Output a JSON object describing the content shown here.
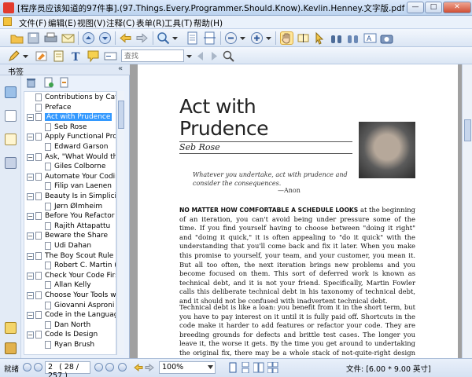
{
  "window": {
    "title": "[程序员应该知道的97件事].(97.Things.Every.Programmer.Should.Know).Kevlin.Henney.文字版.pdf - 福昕阅读器 - [程序员应该知",
    "minimize": "—",
    "maximize": "□",
    "close": "✕"
  },
  "menu": {
    "items": [
      "文件(F)",
      "编辑(E)",
      "视图(V)",
      "注释(C)",
      "表单(R)",
      "工具(T)",
      "帮助(H)"
    ]
  },
  "toolbar": {
    "search_placeholder": "查找"
  },
  "leftpane": {
    "header_label": "书签",
    "collapse_glyph": "«",
    "bookmarks": [
      {
        "label": "Contributions by Catego",
        "type": "chapter",
        "expander": ""
      },
      {
        "label": "Preface",
        "type": "chapter",
        "expander": ""
      },
      {
        "label": "Act with Prudence",
        "type": "chapter",
        "expander": "−",
        "selected": true
      },
      {
        "label": "Seb Rose",
        "type": "author"
      },
      {
        "label": "Apply Functional Progra",
        "type": "chapter",
        "expander": "−"
      },
      {
        "label": "Edward Garson",
        "type": "author"
      },
      {
        "label": "Ask, \"What Would the",
        "type": "chapter",
        "expander": "−"
      },
      {
        "label": "Giles Colborne",
        "type": "author"
      },
      {
        "label": "Automate Your Coding",
        "type": "chapter",
        "expander": "−"
      },
      {
        "label": "Filip van Laenen",
        "type": "author"
      },
      {
        "label": "Beauty Is in Simplicity",
        "type": "chapter",
        "expander": "−"
      },
      {
        "label": "Jørn Ølmheim",
        "type": "author"
      },
      {
        "label": "Before You Refactor",
        "type": "chapter",
        "expander": "−"
      },
      {
        "label": "Rajith Attapattu",
        "type": "author"
      },
      {
        "label": "Beware the Share",
        "type": "chapter",
        "expander": "−"
      },
      {
        "label": "Udi Dahan",
        "type": "author"
      },
      {
        "label": "The Boy Scout Rule",
        "type": "chapter",
        "expander": "−"
      },
      {
        "label": "Robert C. Martin (Un",
        "type": "author"
      },
      {
        "label": "Check Your Code First I",
        "type": "chapter",
        "expander": "−"
      },
      {
        "label": "Allan Kelly",
        "type": "author"
      },
      {
        "label": "Choose Your Tools with",
        "type": "chapter",
        "expander": "−"
      },
      {
        "label": "Giovanni Asproni",
        "type": "author"
      },
      {
        "label": "Code in the Language o",
        "type": "chapter",
        "expander": "−"
      },
      {
        "label": "Dan North",
        "type": "author"
      },
      {
        "label": "Code Is Design",
        "type": "chapter",
        "expander": "−"
      },
      {
        "label": "Ryan Brush",
        "type": "author"
      }
    ]
  },
  "document": {
    "chapter_title_line1": "Act with",
    "chapter_title_line2": "Prudence",
    "author": "Seb Rose",
    "quote": "Whatever you undertake, act with prudence and consider the consequences.",
    "quote_attribution": "—Anon",
    "para1_lead": "NO MATTER HOW COMFORTABLE A SCHEDULE LOOKS",
    "para1": " at the beginning of an iteration, you can't avoid being under pressure some of the time. If you find yourself having to choose between \"doing it right\" and \"doing it quick,\" it is often appealing to \"do it quick\" with the understanding that you'll come back and fix it later. When you make this promise to yourself, your team, and your customer, you mean it. But all too often, the next iteration brings new problems and you become focused on them. This sort of deferred work is known as technical debt, and it is not your friend. Specifically, Martin Fowler calls this deliberate technical debt in his taxonomy of technical debt, and it should not be confused with inadvertent technical debt.",
    "para2": "Technical debt is like a loan: you benefit from it in the short term, but you have to pay interest on it until it is fully paid off. Shortcuts in the code make it harder to add features or refactor your code. They are breeding grounds for defects and brittle test cases. The longer you leave it, the worse it gets. By the time you get around to undertaking the original fix, there may be a whole stack of not-quite-right design choices layered on top of the original problem."
  },
  "statusbar": {
    "ready": "就绪",
    "page_number": "2",
    "page_info": "( 28 / 257 )",
    "zoom": "100%",
    "file_size": "文件: [6.00 * 9.00 英寸]"
  },
  "colors": {
    "selection": "#3399ff",
    "chrome": "#dfe8f5",
    "page_bg": "#a0a0a0"
  }
}
